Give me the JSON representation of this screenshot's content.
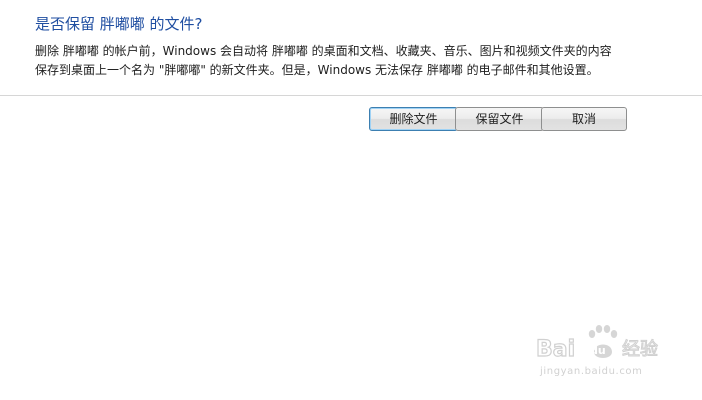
{
  "dialog": {
    "title": "是否保留 胖嘟嘟 的文件?",
    "description_lines": [
      "删除 胖嘟嘟 的帐户前，Windows 会自动将 胖嘟嘟 的桌面和文档、收藏夹、音乐、图片和视频文件夹的内容",
      "保存到桌面上一个名为 \"胖嘟嘟\" 的新文件夹。但是，Windows 无法保存 胖嘟嘟 的电子邮件和其他设置。"
    ]
  },
  "buttons": {
    "delete_files": "删除文件",
    "keep_files": "保留文件",
    "cancel": "取消"
  },
  "watermark": {
    "logo_text": "Baidu经验",
    "url": "jingyan.baidu.com"
  }
}
